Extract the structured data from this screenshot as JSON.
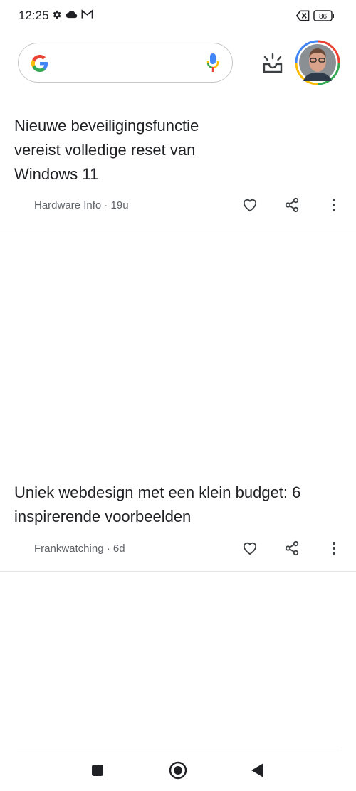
{
  "status": {
    "time": "12:25",
    "battery": "86",
    "icons": [
      "gear-icon",
      "cloud-icon",
      "gmail-icon",
      "no-sim-icon",
      "battery-icon"
    ]
  },
  "header": {
    "search_icons": [
      "google-logo-icon",
      "microphone-icon"
    ],
    "discover_icon": "sunrise-icon",
    "avatar": "profile-avatar"
  },
  "cards": [
    {
      "title_lines": [
        "Nieuwe beveiligingsfunctie",
        "vereist volledige reset van",
        "Windows 11"
      ],
      "source": "Hardware Info · 19u",
      "actions": [
        "heart-icon",
        "share-icon",
        "more-vert-icon"
      ]
    },
    {
      "title_lines": [
        "Uniek webdesign met een klein budget: 6",
        "inspirerende voorbeelden"
      ],
      "source": "Frankwatching · 6d",
      "actions": [
        "heart-icon",
        "share-icon",
        "more-vert-icon"
      ]
    }
  ],
  "nav": {
    "buttons": [
      "recents-square-icon",
      "home-circle-icon",
      "back-triangle-icon"
    ]
  },
  "colors": {
    "google_blue": "#4285F4",
    "google_red": "#EA4335",
    "google_yellow": "#FBBC05",
    "google_green": "#34A853",
    "text": "#202124",
    "secondary_text": "#5f6368"
  }
}
